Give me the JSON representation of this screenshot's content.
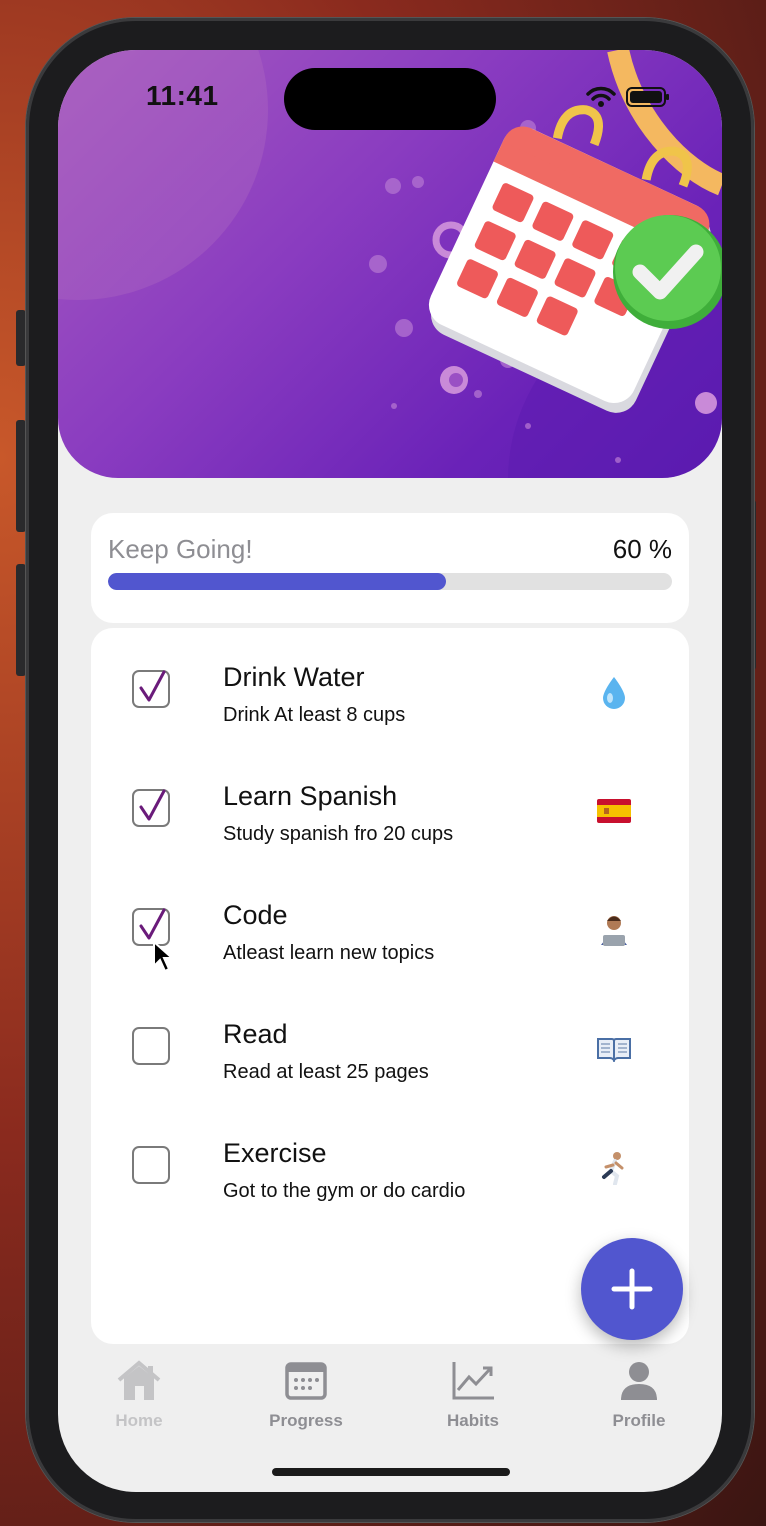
{
  "status_bar": {
    "time": "11:41"
  },
  "progress": {
    "label": "Keep Going!",
    "percent_text": "60 %",
    "value": 0.6,
    "fill_color": "#5156cf"
  },
  "habits": [
    {
      "title": "Drink Water",
      "subtitle": "Drink At least 8 cups",
      "checked": true,
      "icon": "droplet-icon"
    },
    {
      "title": "Learn Spanish",
      "subtitle": "Study spanish fro 20 cups",
      "checked": true,
      "icon": "spain-flag-icon"
    },
    {
      "title": "Code",
      "subtitle": "Atleast learn new topics",
      "checked": true,
      "icon": "technologist-icon"
    },
    {
      "title": "Read",
      "subtitle": "Read at least 25 pages",
      "checked": false,
      "icon": "open-book-icon"
    },
    {
      "title": "Exercise",
      "subtitle": "Got to the gym or do cardio",
      "checked": false,
      "icon": "runner-icon"
    }
  ],
  "fab": {
    "icon": "plus-icon",
    "color": "#5156cf"
  },
  "tabs": [
    {
      "label": "Home",
      "icon": "home-icon",
      "active": false
    },
    {
      "label": "Progress",
      "icon": "calendar-icon",
      "active": false
    },
    {
      "label": "Habits",
      "icon": "chart-icon",
      "active": false
    },
    {
      "label": "Profile",
      "icon": "person-icon",
      "active": true
    }
  ],
  "colors": {
    "check": "#6a1b7a",
    "header_gradient_start": "#a65bbf",
    "header_gradient_end": "#5a1cb0"
  }
}
